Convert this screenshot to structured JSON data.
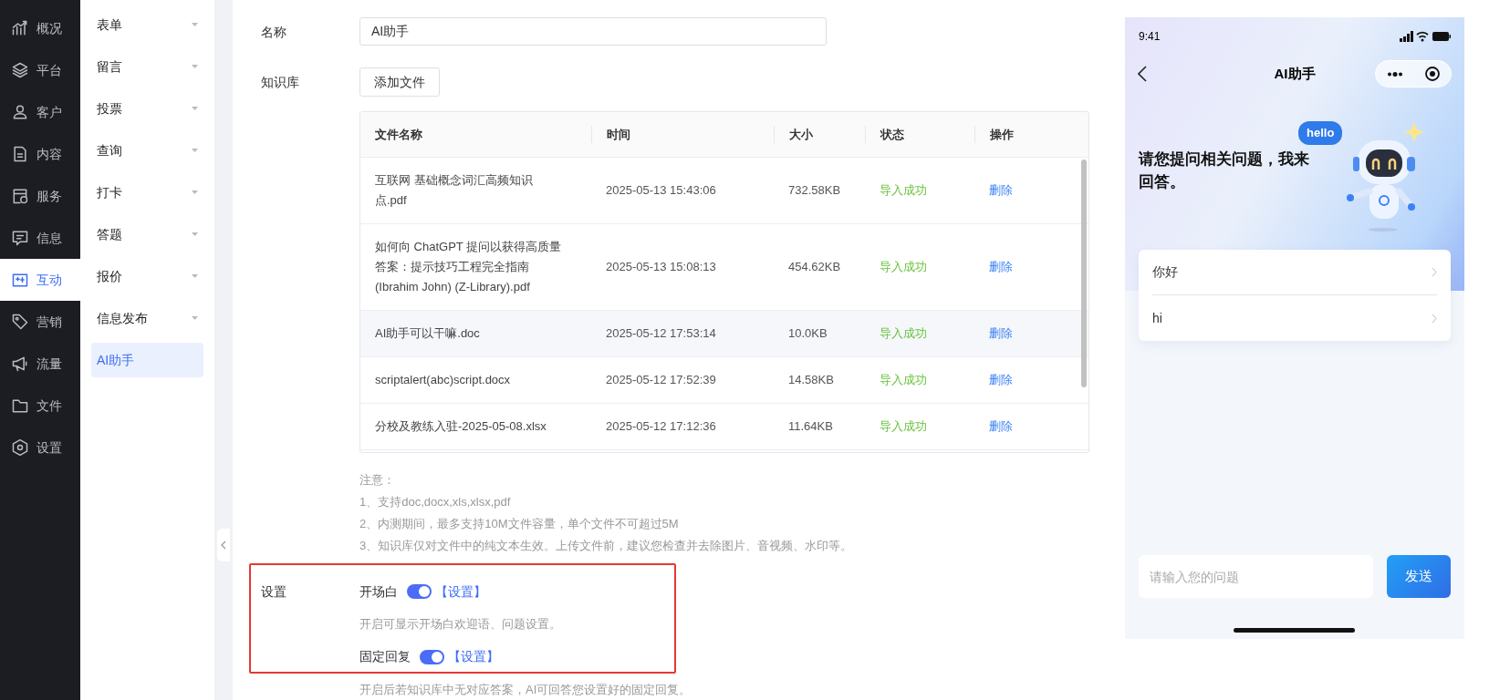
{
  "nav": [
    {
      "label": "概况",
      "selected": false
    },
    {
      "label": "平台",
      "selected": false
    },
    {
      "label": "客户",
      "selected": false
    },
    {
      "label": "内容",
      "selected": false
    },
    {
      "label": "服务",
      "selected": false
    },
    {
      "label": "信息",
      "selected": false
    },
    {
      "label": "互动",
      "selected": true
    },
    {
      "label": "营销",
      "selected": false
    },
    {
      "label": "流量",
      "selected": false
    },
    {
      "label": "文件",
      "selected": false
    },
    {
      "label": "设置",
      "selected": false
    }
  ],
  "submenu": [
    {
      "label": "表单",
      "kind": "group",
      "selected": false
    },
    {
      "label": "留言",
      "kind": "group",
      "selected": false
    },
    {
      "label": "投票",
      "kind": "group",
      "selected": false
    },
    {
      "label": "查询",
      "kind": "group",
      "selected": false
    },
    {
      "label": "打卡",
      "kind": "group",
      "selected": false
    },
    {
      "label": "答题",
      "kind": "group",
      "selected": false
    },
    {
      "label": "报价",
      "kind": "group",
      "selected": false
    },
    {
      "label": "信息发布",
      "kind": "group",
      "selected": false
    },
    {
      "label": "AI助手",
      "kind": "page",
      "selected": true
    }
  ],
  "form": {
    "name_label": "名称",
    "name_value": "AI助手",
    "kb_label": "知识库",
    "add_button": "添加文件"
  },
  "table": {
    "columns": [
      "文件名称",
      "时间",
      "大小",
      "状态",
      "操作"
    ],
    "rows": [
      [
        "互联网 基础概念词汇高频知识点.pdf",
        "2025-05-13 15:43:06",
        "732.58KB",
        "导入成功",
        "删除"
      ],
      [
        "如何向 ChatGPT 提问以获得高质量答案：提示技巧工程完全指南 (Ibrahim John) (Z-Library).pdf",
        "2025-05-13 15:08:13",
        "454.62KB",
        "导入成功",
        "删除"
      ],
      [
        "AI助手可以干嘛.doc",
        "2025-05-12 17:53:14",
        "10.0KB",
        "导入成功",
        "删除"
      ],
      [
        "scriptalert(abc)script.docx",
        "2025-05-12 17:52:39",
        "14.58KB",
        "导入成功",
        "删除"
      ],
      [
        "分校及教练入驻-2025-05-08.xlsx",
        "2025-05-12 17:12:36",
        "11.64KB",
        "导入成功",
        "删除"
      ]
    ]
  },
  "notes": [
    "注意：",
    "1、支持doc,docx,xls,xlsx,pdf",
    "2、内测期间，最多支持10M文件容量，单个文件不可超过5M",
    "3、知识库仅对文件中的纯文本生效。上传文件前，建议您检查并去除图片、音视频、水印等。"
  ],
  "settings": {
    "label": "设置",
    "items": [
      {
        "label": "开场白",
        "on": true,
        "link": "【设置】",
        "description": "开启可显示开场白欢迎语、问题设置。"
      },
      {
        "label": "固定回复",
        "on": true,
        "link": "【设置】",
        "description": "开启后若知识库中无对应答案，AI可回答您设置好的固定回复。"
      }
    ]
  },
  "phone": {
    "time": "9:41",
    "title": "AI助手",
    "bubble": "hello",
    "heading": "请您提问相关问题，我来回答。",
    "suggestions": [
      "你好",
      "hi"
    ],
    "input_placeholder": "请输入您的问题",
    "send_button": "发送"
  }
}
